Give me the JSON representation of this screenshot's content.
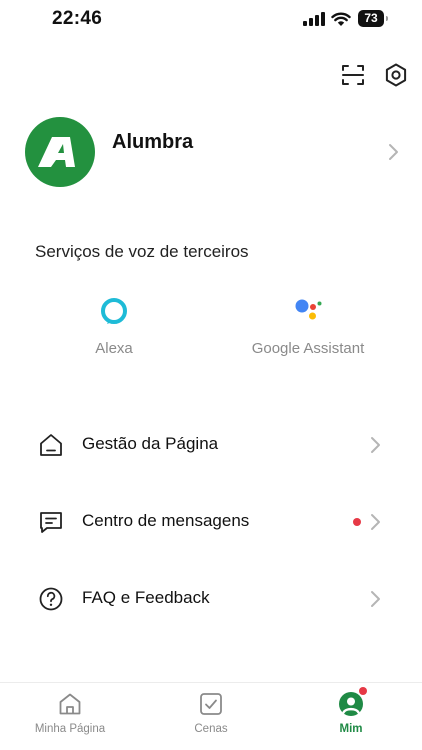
{
  "status_bar": {
    "time": "22:46",
    "battery": "73"
  },
  "top_actions": {
    "scan_icon": "scan-icon",
    "settings_icon": "settings-icon"
  },
  "profile": {
    "name": "Alumbra",
    "avatar_letter": "A",
    "avatar_color": "#23913f"
  },
  "voice_services": {
    "title": "Serviços de voz de terceiros",
    "items": [
      {
        "label": "Alexa",
        "icon": "alexa-icon",
        "color": "#1ebbd7"
      },
      {
        "label": "Google Assistant",
        "icon": "google-assistant-icon"
      }
    ]
  },
  "menu": {
    "items": [
      {
        "label": "Gestão da Página",
        "icon": "home-outline-icon"
      },
      {
        "label": "Centro de mensagens",
        "icon": "message-icon",
        "unread_dot": true
      },
      {
        "label": "FAQ e Feedback",
        "icon": "help-circle-icon"
      }
    ]
  },
  "tab_bar": {
    "tabs": [
      {
        "label": "Minha Página",
        "icon": "home-icon",
        "active": false
      },
      {
        "label": "Cenas",
        "icon": "scenes-checkbox-icon",
        "active": false
      },
      {
        "label": "Mim",
        "icon": "profile-icon",
        "active": true,
        "badge": true
      }
    ],
    "active_color": "#1f8a45"
  },
  "colors": {
    "accent": "#1f8a45",
    "badge": "#e63946",
    "muted_text": "#8a8a8a"
  }
}
